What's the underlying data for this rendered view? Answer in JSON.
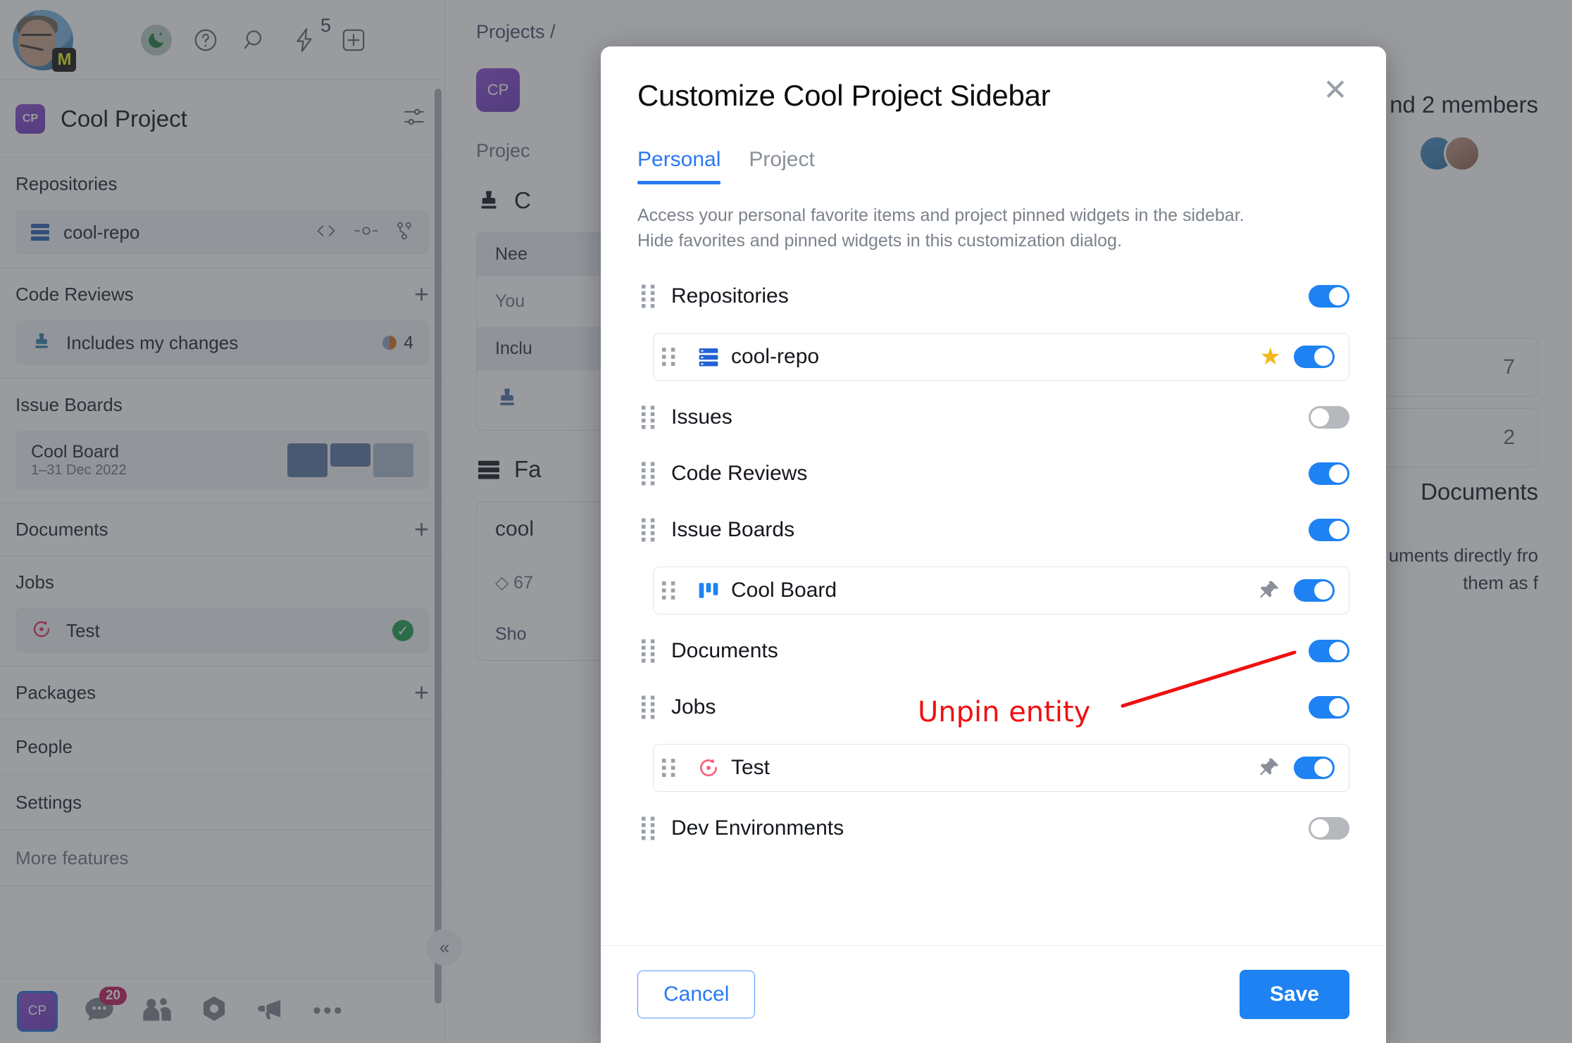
{
  "topbar": {
    "icons": [
      {
        "name": "moon-icon",
        "glyph": "☽"
      },
      {
        "name": "help-icon",
        "glyph": "?"
      },
      {
        "name": "search-icon",
        "glyph": "⌕"
      },
      {
        "name": "lightning-icon",
        "glyph": "⚡"
      },
      {
        "name": "add-icon",
        "glyph": "+"
      }
    ],
    "lightning_badge": "5",
    "avatar_badge": "M"
  },
  "sidebar": {
    "project": {
      "initials": "CP",
      "name": "Cool Project"
    },
    "sections": [
      {
        "title": "Repositories",
        "has_plus": false
      },
      {
        "title": "Code Reviews",
        "has_plus": true
      },
      {
        "title": "Issue Boards",
        "has_plus": false
      },
      {
        "title": "Documents",
        "has_plus": true
      },
      {
        "title": "Jobs",
        "has_plus": false
      },
      {
        "title": "Packages",
        "has_plus": true
      },
      {
        "title": "People",
        "has_plus": false
      },
      {
        "title": "Settings",
        "has_plus": false
      },
      {
        "title": "More features",
        "has_plus": false
      }
    ],
    "repo": {
      "name": "cool-repo"
    },
    "code_review": {
      "name": "Includes my changes",
      "count": "4"
    },
    "board": {
      "name": "Cool Board",
      "date": "1–31 Dec 2022"
    },
    "job": {
      "name": "Test",
      "status": "✓"
    },
    "bottom": {
      "project_initials": "CP",
      "chat_badge": "20",
      "more": "•••"
    },
    "collapse_glyph": "«"
  },
  "main": {
    "breadcrumb": "Projects /",
    "project_initials": "CP",
    "project_label": "Projec",
    "members_text": "nd 2 members",
    "section_code_reviews": "C",
    "panel_header": "Nee",
    "panel_body_1": "You",
    "panel_body_2": "Inclu",
    "section_favorites": "Fa",
    "fav_repo": "cool",
    "fav_repo_meta": "◇ 67",
    "fav_show": "Sho",
    "stat_1": "7",
    "stat_2": "2",
    "docs_title": "Documents",
    "docs_text_1": "uments directly fro",
    "docs_text_2": "them as f"
  },
  "modal": {
    "title": "Customize Cool Project Sidebar",
    "close_glyph": "✕",
    "tabs": [
      {
        "label": "Personal",
        "active": true
      },
      {
        "label": "Project",
        "active": false
      }
    ],
    "description_line_1": "Access your personal favorite items and project pinned widgets in the sidebar.",
    "description_line_2": "Hide favorites and pinned widgets in this customization dialog.",
    "rows": [
      {
        "label": "Repositories",
        "type": "group",
        "toggle": "on",
        "icon": null,
        "action": null
      },
      {
        "label": "cool-repo",
        "type": "child",
        "toggle": "on",
        "icon": "repo-icon",
        "action": "star-icon"
      },
      {
        "label": "Issues",
        "type": "group",
        "toggle": "off",
        "icon": null,
        "action": null
      },
      {
        "label": "Code Reviews",
        "type": "group",
        "toggle": "on",
        "icon": null,
        "action": null
      },
      {
        "label": "Issue Boards",
        "type": "group",
        "toggle": "on",
        "icon": null,
        "action": null
      },
      {
        "label": "Cool Board",
        "type": "child",
        "toggle": "on",
        "icon": "board-icon",
        "action": "pin-icon"
      },
      {
        "label": "Documents",
        "type": "group",
        "toggle": "on",
        "icon": null,
        "action": null
      },
      {
        "label": "Jobs",
        "type": "group",
        "toggle": "on",
        "icon": null,
        "action": null
      },
      {
        "label": "Test",
        "type": "child",
        "toggle": "on",
        "icon": "job-icon",
        "action": "pin-icon"
      },
      {
        "label": "Dev Environments",
        "type": "group",
        "toggle": "off",
        "icon": null,
        "action": null
      }
    ],
    "cancel_label": "Cancel",
    "save_label": "Save"
  },
  "annotation": {
    "text": "Unpin entity",
    "color": "#ef1010"
  },
  "colors": {
    "accent_blue": "#1e82f3",
    "tab_blue": "#2979f2",
    "toggle_off_gray": "#b5b8bc",
    "star_gold": "#f5b81a",
    "pin_gray": "#8a9099",
    "project_purple": "#6f3bbd",
    "annotation_red": "#ef1010"
  }
}
